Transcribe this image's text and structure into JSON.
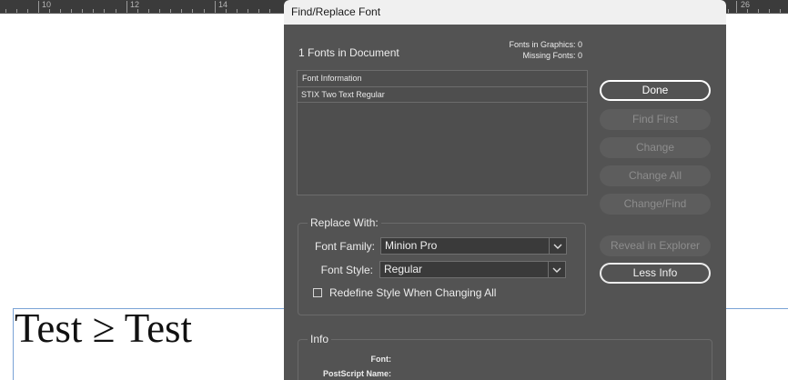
{
  "ruler": {
    "numbers": [
      "10",
      "12",
      "14",
      "26"
    ]
  },
  "document": {
    "text": "Test ≥ Test"
  },
  "dialog": {
    "title": "Find/Replace Font",
    "fonts_count": "1 Fonts in Document",
    "fonts_in_graphics": "Fonts in Graphics: 0",
    "missing_fonts": "Missing Fonts: 0",
    "font_list": {
      "header": "Font Information",
      "rows": [
        "STIX Two Text Regular"
      ]
    },
    "buttons": {
      "done": "Done",
      "find_first": "Find First",
      "change": "Change",
      "change_all": "Change All",
      "change_find": "Change/Find",
      "reveal": "Reveal in Explorer",
      "less_info": "Less Info"
    },
    "replace": {
      "legend": "Replace With:",
      "family_label": "Font Family:",
      "family_value": "Minion Pro",
      "style_label": "Font Style:",
      "style_value": "Regular",
      "redefine_label": "Redefine Style When Changing All",
      "redefine_checked": false
    },
    "info": {
      "legend": "Info",
      "font_label": "Font:",
      "postscript_label": "PostScript Name:"
    }
  }
}
